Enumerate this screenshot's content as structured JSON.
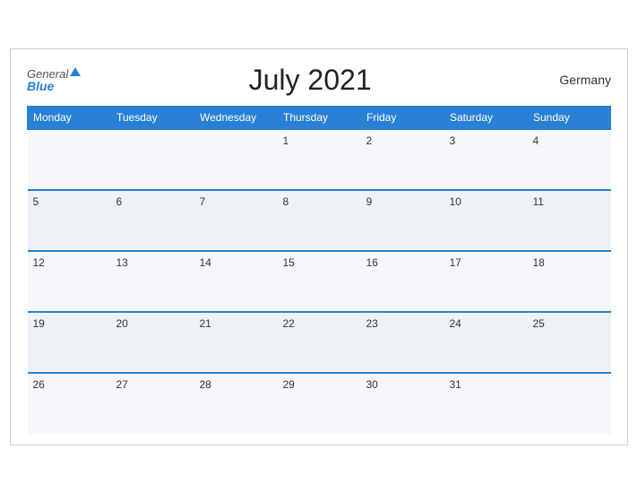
{
  "header": {
    "logo_general": "General",
    "logo_blue": "Blue",
    "month_title": "July 2021",
    "country": "Germany"
  },
  "weekdays": [
    "Monday",
    "Tuesday",
    "Wednesday",
    "Thursday",
    "Friday",
    "Saturday",
    "Sunday"
  ],
  "weeks": [
    [
      "",
      "",
      "",
      "1",
      "2",
      "3",
      "4"
    ],
    [
      "5",
      "6",
      "7",
      "8",
      "9",
      "10",
      "11"
    ],
    [
      "12",
      "13",
      "14",
      "15",
      "16",
      "17",
      "18"
    ],
    [
      "19",
      "20",
      "21",
      "22",
      "23",
      "24",
      "25"
    ],
    [
      "26",
      "27",
      "28",
      "29",
      "30",
      "31",
      ""
    ]
  ]
}
